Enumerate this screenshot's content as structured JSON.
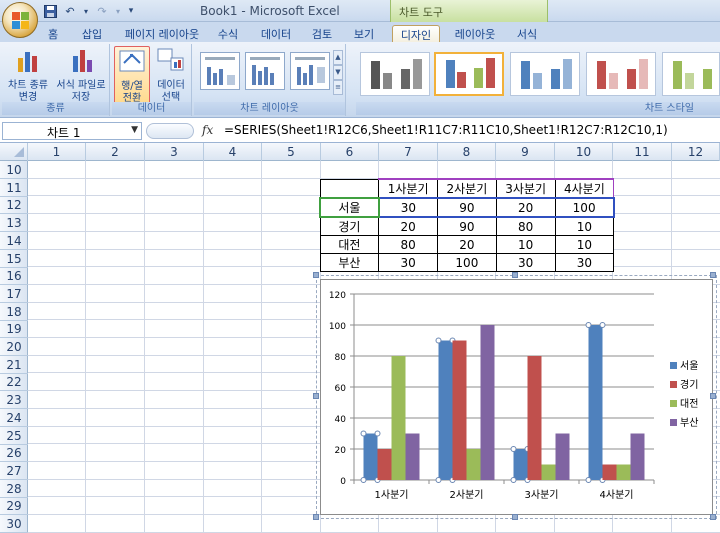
{
  "app": {
    "title": "Book1  -  Microsoft Excel",
    "contextual_tab": "차트 도구"
  },
  "qat": {
    "undo_icon": "undo-icon",
    "redo_icon": "redo-icon",
    "more": "▾"
  },
  "tabs": [
    "홈",
    "삽입",
    "페이지 레이아웃",
    "수식",
    "데이터",
    "검토",
    "보기",
    "디자인",
    "레이아웃",
    "서식"
  ],
  "active_tab": "디자인",
  "ribbon": {
    "groups": {
      "type": {
        "label": "종류",
        "btn1": "차트 종류\n변경",
        "btn2": "서식 파일로\n저장"
      },
      "data": {
        "label": "데이터",
        "btn1": "행/열\n전환",
        "btn2": "데이터\n선택"
      },
      "layout": {
        "label": "차트 레이아웃"
      },
      "styles": {
        "label": "차트 스타일"
      }
    }
  },
  "formula_bar": {
    "name_box": "차트 1",
    "fx": "fx",
    "formula": "=SERIES(Sheet1!R12C6,Sheet1!R11C7:R11C10,Sheet1!R12C7:R12C10,1)"
  },
  "columns": [
    "1",
    "2",
    "3",
    "4",
    "5",
    "6",
    "7",
    "8",
    "9",
    "10",
    "11",
    "12"
  ],
  "rows": [
    "10",
    "11",
    "12",
    "13",
    "14",
    "15",
    "16",
    "17",
    "18",
    "19",
    "20",
    "21",
    "22",
    "23",
    "24",
    "25",
    "26",
    "27",
    "28",
    "29",
    "30"
  ],
  "table": {
    "headers": [
      "1사분기",
      "2사분기",
      "3사분기",
      "4사분기"
    ],
    "rows": [
      {
        "label": "서울",
        "values": [
          "30",
          "90",
          "20",
          "100"
        ]
      },
      {
        "label": "경기",
        "values": [
          "20",
          "90",
          "80",
          "10"
        ]
      },
      {
        "label": "대전",
        "values": [
          "80",
          "20",
          "10",
          "10"
        ]
      },
      {
        "label": "부산",
        "values": [
          "30",
          "100",
          "30",
          "30"
        ]
      }
    ]
  },
  "chart_data": {
    "type": "bar",
    "categories": [
      "1사분기",
      "2사분기",
      "3사분기",
      "4사분기"
    ],
    "series": [
      {
        "name": "서울",
        "values": [
          30,
          90,
          20,
          100
        ],
        "color": "#4f81bd"
      },
      {
        "name": "경기",
        "values": [
          20,
          90,
          80,
          10
        ],
        "color": "#c0504d"
      },
      {
        "name": "대전",
        "values": [
          80,
          20,
          10,
          10
        ],
        "color": "#9bbb59"
      },
      {
        "name": "부산",
        "values": [
          30,
          100,
          30,
          30
        ],
        "color": "#8064a2"
      }
    ],
    "yticks": [
      "0",
      "20",
      "40",
      "60",
      "80",
      "100",
      "120"
    ],
    "ylim": [
      0,
      120
    ],
    "grid": true,
    "legend": "right"
  }
}
